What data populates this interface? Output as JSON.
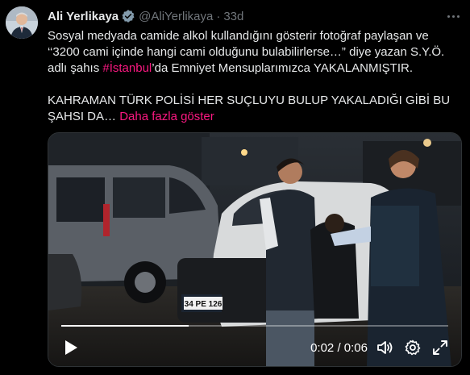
{
  "author": {
    "name": "Ali Yerlikaya",
    "handle": "@AliYerlikaya",
    "separator": "·",
    "time": "33d"
  },
  "tweet": {
    "line1": "Sosyal medyada camide alkol kullandığını gösterir fotoğraf paylaşan ve",
    "line2": "‘‘3200 cami içinde hangi cami olduğunu bulabilirlerse…” diye yazan S.Y.Ö.",
    "line3_pre": "adlı şahıs ",
    "hashtag": "#İstanbul",
    "line3_post": "’da Emniyet Mensuplarımızca YAKALANMIŞTIR.",
    "line4": "KAHRAMAN TÜRK POLİSİ HER SUÇLUYU BULUP YAKALADIĞI GİBİ BU",
    "line5": "ŞAHSI DA…",
    "show_more": "Daha fazla göster"
  },
  "video": {
    "current": "0:02",
    "divider": "/",
    "duration": "0:06",
    "progress": 0.33,
    "plate_text": "34 PE 126"
  },
  "colors": {
    "accent": "#f91880",
    "verified": "#829aab",
    "muted": "#71767b"
  }
}
